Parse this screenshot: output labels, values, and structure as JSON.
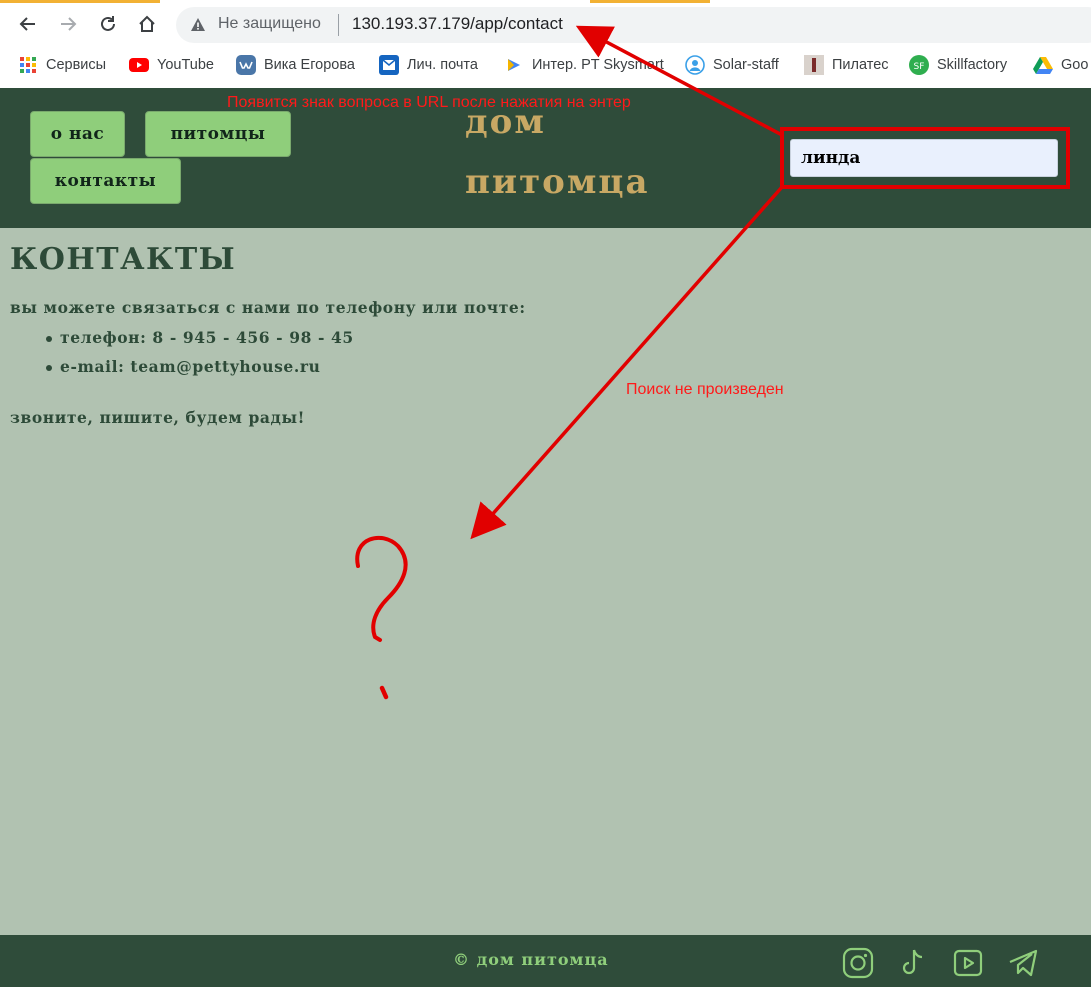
{
  "browser": {
    "security_label": "Не защищено",
    "url": "130.193.37.179/app/contact",
    "bookmarks": [
      {
        "label": "Сервисы",
        "icon": "apps-grid-icon"
      },
      {
        "label": "YouTube",
        "icon": "youtube-icon"
      },
      {
        "label": "Вика Егорова",
        "icon": "vk-icon"
      },
      {
        "label": "Лич. почта",
        "icon": "mail-icon"
      },
      {
        "label": "Интер. PT Skysmart",
        "icon": "skysmart-icon"
      },
      {
        "label": "Solar-staff",
        "icon": "solar-staff-icon"
      },
      {
        "label": "Пилатес",
        "icon": "pilates-icon"
      },
      {
        "label": "Skillfactory",
        "icon": "skillfactory-icon"
      },
      {
        "label": "Goo",
        "icon": "google-drive-icon"
      }
    ]
  },
  "site": {
    "nav": {
      "about": "о нас",
      "pets": "питомцы",
      "contacts": "контакты"
    },
    "brand_line1": "дом",
    "brand_line2": "питомца",
    "search_value": "линда",
    "page_title": "КОНТАКТЫ",
    "intro": "вы можете связаться с нами по телефону или почте:",
    "contacts": [
      "телефон: 8 - 945 - 456 - 98 - 45",
      "e-mail: team@pettyhouse.ru"
    ],
    "outro": "звоните, пишите, будем рады!",
    "footer_copyright": "© дом питомца",
    "social_icons": [
      "instagram-icon",
      "tiktok-icon",
      "youtube-play-icon",
      "telegram-icon"
    ]
  },
  "annotations": {
    "header_note": "Появится знак вопроса в URL после нажатия на энтер",
    "search_note": "Поиск не произведен"
  },
  "colors": {
    "header_bg": "#2f4c3a",
    "content_bg": "#b1c2b1",
    "nav_button": "#8fce7b",
    "brand": "#c8a864",
    "annotation": "#ff1a1a"
  }
}
